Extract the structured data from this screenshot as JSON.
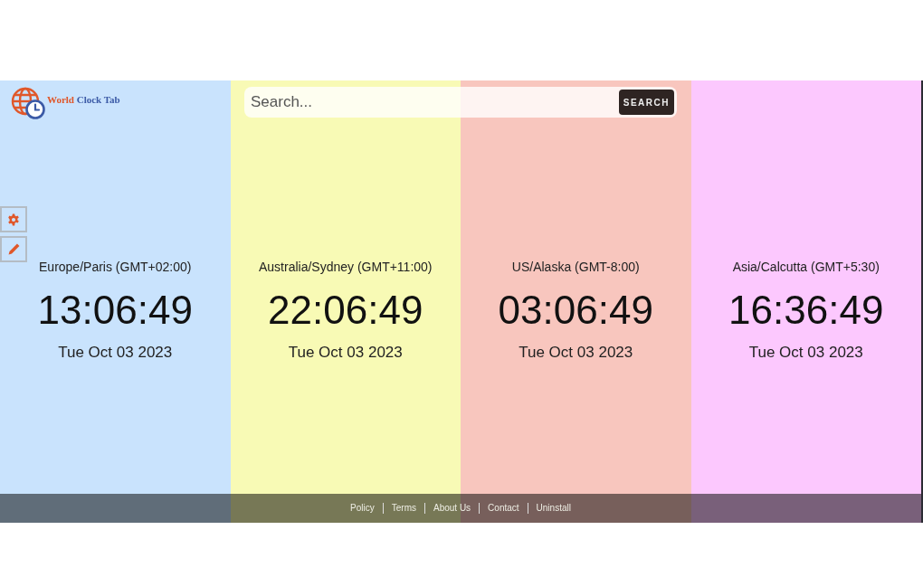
{
  "logo": {
    "text_1": "World",
    "text_2": "Clock Tab"
  },
  "search": {
    "placeholder": "Search...",
    "button": "SEARCH"
  },
  "side_tools": [
    {
      "kind": "settings"
    },
    {
      "kind": "edit"
    }
  ],
  "clocks": [
    {
      "zone": "Europe/Paris (GMT+02:00)",
      "time": "13:06:49",
      "date": "Tue Oct 03 2023",
      "color": "#c9e3fd"
    },
    {
      "zone": "Australia/Sydney (GMT+11:00)",
      "time": "22:06:49",
      "date": "Tue Oct 03 2023",
      "color": "#f8fab5"
    },
    {
      "zone": "US/Alaska (GMT-8:00)",
      "time": "03:06:49",
      "date": "Tue Oct 03 2023",
      "color": "#f8c6be"
    },
    {
      "zone": "Asia/Calcutta (GMT+5:30)",
      "time": "16:36:49",
      "date": "Tue Oct 03 2023",
      "color": "#fcc8fe"
    }
  ],
  "footer_links": [
    "Policy",
    "Terms",
    "About Us",
    "Contact",
    "Uninstall"
  ]
}
